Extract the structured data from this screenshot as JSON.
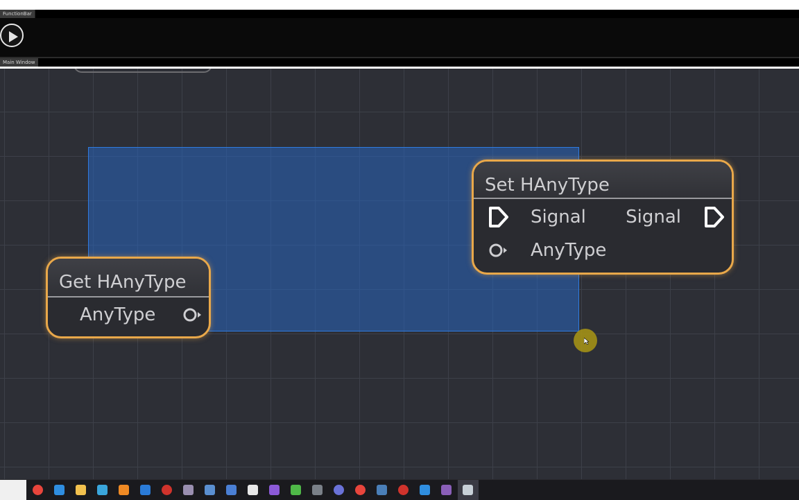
{
  "tabs": {
    "function_bar": "FunctionBar",
    "main_window": "Main Window"
  },
  "colors": {
    "canvas": "#2d2f36",
    "grid": "#3d4049",
    "node_border": "#e9a84a",
    "selection": "#2864be",
    "node_body": "#2a2b30"
  },
  "nodes": {
    "get": {
      "title": "Get HAnyType",
      "output_label": "AnyType"
    },
    "set": {
      "title": "Set HAnyType",
      "signal_in_label": "Signal",
      "signal_out_label": "Signal",
      "value_in_label": "AnyType"
    }
  },
  "taskbar": {
    "icons": [
      "chrome-icon",
      "edge-icon",
      "file-explorer-icon",
      "notes-icon",
      "blender-icon",
      "mail-icon",
      "record-icon",
      "app-icon",
      "app-icon",
      "calculator-icon",
      "document-icon",
      "visual-studio-icon",
      "minecraft-icon",
      "app-icon",
      "discord-icon",
      "chrome-icon",
      "steam-icon",
      "obs-icon",
      "paint-icon",
      "app-icon",
      "active-window-icon"
    ]
  }
}
